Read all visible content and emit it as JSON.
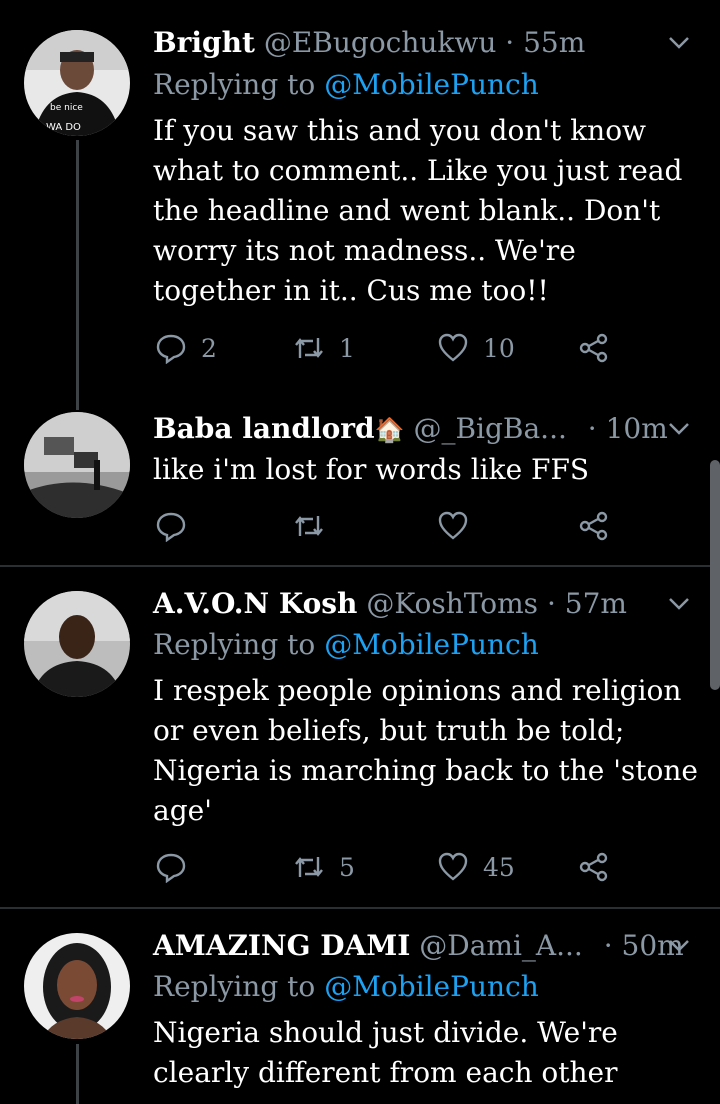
{
  "tweets": [
    {
      "name": "Bright",
      "handle": "@EBugochukwu",
      "dot": "·",
      "time": "55m",
      "reply_prefix": "Replying to",
      "reply_to": "@MobilePunch",
      "text": "If you saw this and you don't know what to comment.. Like you just read the headline and went blank.. Don't worry its not madness.. We're together in it.. Cus me too!!",
      "replies": "2",
      "retweets": "1",
      "likes": "10"
    },
    {
      "name": "Baba landlord",
      "emoji": "🏠",
      "handle": "@_BigBa...",
      "dot": "·",
      "time": "10m",
      "text": "like i'm lost for words like FFS",
      "replies": "",
      "retweets": "",
      "likes": ""
    },
    {
      "name": "A.V.O.N Kosh",
      "handle": "@KoshToms",
      "dot": "·",
      "time": "57m",
      "reply_prefix": "Replying to",
      "reply_to": "@MobilePunch",
      "text": "I respek people opinions and religion or even beliefs, but truth be told; Nigeria is marching back to the 'stone age'",
      "replies": "",
      "retweets": "5",
      "likes": "45"
    },
    {
      "name": "AMAZING DAMI",
      "handle": "@Dami_A...",
      "dot": "·",
      "time": "50m",
      "reply_prefix": "Replying to",
      "reply_to": "@MobilePunch",
      "text": "Nigeria should just divide. We're clearly different from each other"
    }
  ],
  "colors": {
    "background": "#000000",
    "muted": "#8b98a5",
    "link": "#1da1f2",
    "divider": "#2a2f33"
  },
  "icons": [
    "reply-icon",
    "retweet-icon",
    "like-icon",
    "share-icon",
    "chevron-down-icon"
  ]
}
